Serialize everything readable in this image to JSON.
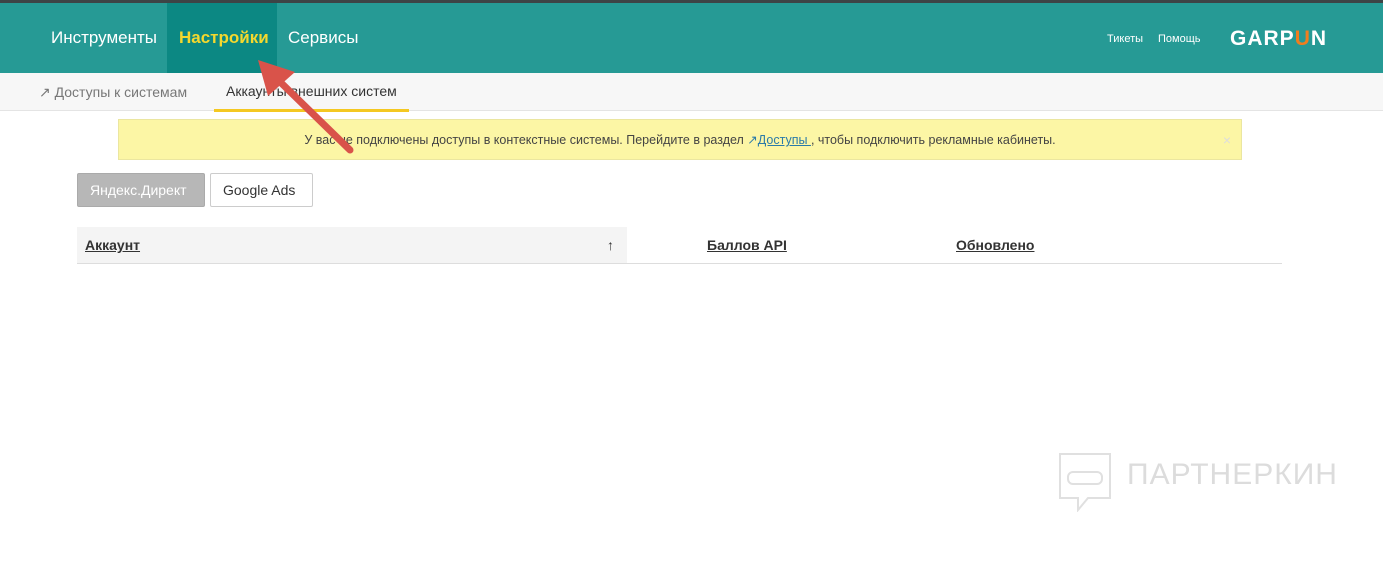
{
  "nav": {
    "items": [
      "Инструменты",
      "Настройки",
      "Сервисы"
    ],
    "active": "Настройки",
    "links": [
      "Тикеты",
      "Помощь"
    ],
    "logo": "GARPUN"
  },
  "subnav": {
    "tabs": [
      "Доступы к системам",
      "Аккаунты внешних систем"
    ],
    "active": "Аккаунты внешних систем"
  },
  "alert": {
    "text_before": "У вас не подключены доступы в контекстные системы. Перейдите в раздел ",
    "link": "Доступы ",
    "text_after": ", чтобы подключить рекламные кабинеты.",
    "close": "×"
  },
  "systems": {
    "buttons": [
      "Яндекс.Директ",
      "Google Ads"
    ],
    "selected": "Яндекс.Директ"
  },
  "table": {
    "columns": [
      "Аккаунт",
      "Баллов API",
      "Обновлено"
    ],
    "sort_icon": "↑"
  },
  "watermark": "ПАРТНЕРКИН",
  "colors": {
    "nav": "#269a95",
    "active_nav": "#0c8883",
    "accent": "#f4d82e",
    "arrow": "#d9534a"
  }
}
